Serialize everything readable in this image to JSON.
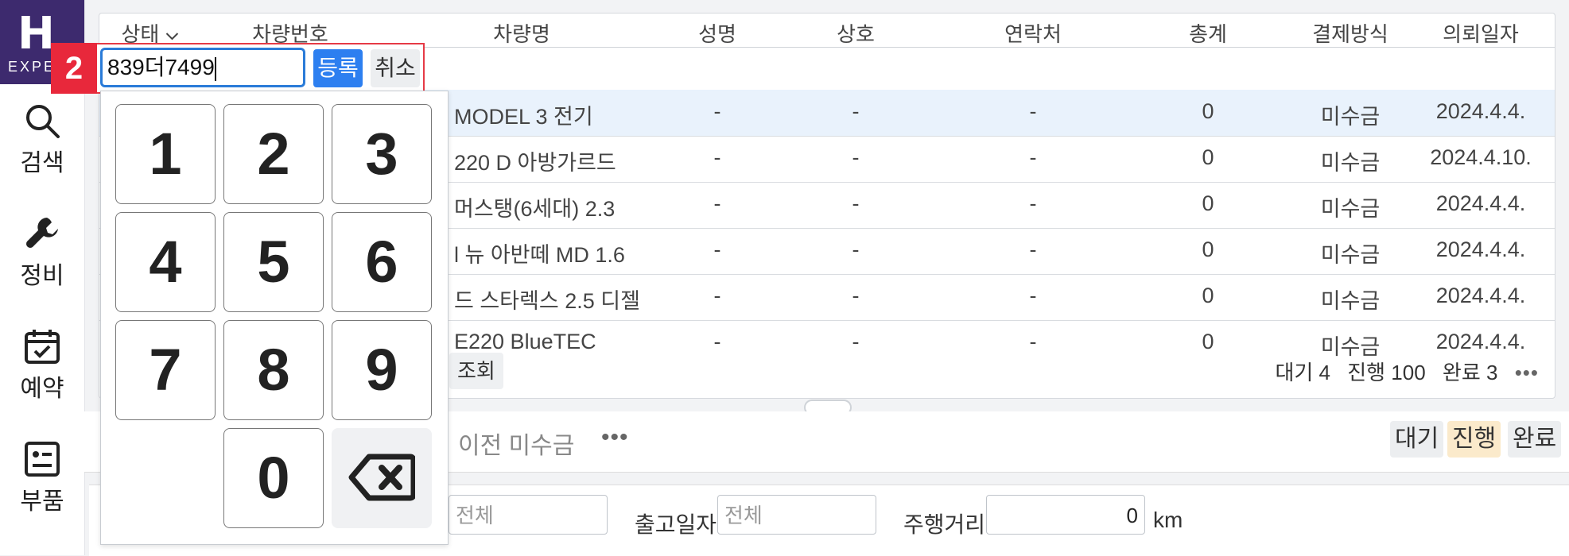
{
  "sidebar": {
    "logo_letter": "H",
    "logo_text": "EXPE",
    "items": [
      {
        "label": "검색",
        "icon": "search-icon"
      },
      {
        "label": "정비",
        "icon": "wrench-icon"
      },
      {
        "label": "예약",
        "icon": "calendar-check-icon"
      },
      {
        "label": "부품",
        "icon": "parts-icon"
      }
    ]
  },
  "table": {
    "headers": [
      "상태",
      "차량번호",
      "차량명",
      "성명",
      "상호",
      "연락처",
      "총계",
      "결제방식",
      "의뢰일자"
    ],
    "rows": [
      {
        "name": "MODEL 3 전기",
        "person": "-",
        "company": "-",
        "contact": "-",
        "total": "0",
        "payment": "미수금",
        "date": "2024.4.4.",
        "selected": true
      },
      {
        "name": "220 D 아방가르드",
        "person": "-",
        "company": "-",
        "contact": "-",
        "total": "0",
        "payment": "미수금",
        "date": "2024.4.10.",
        "selected": false
      },
      {
        "name": "머스탱(6세대) 2.3",
        "person": "-",
        "company": "-",
        "contact": "-",
        "total": "0",
        "payment": "미수금",
        "date": "2024.4.4.",
        "selected": false
      },
      {
        "name": "l 뉴 아반떼 MD 1.6",
        "person": "-",
        "company": "-",
        "contact": "-",
        "total": "0",
        "payment": "미수금",
        "date": "2024.4.4.",
        "selected": false
      },
      {
        "name": "드 스타렉스 2.5 디젤",
        "person": "-",
        "company": "-",
        "contact": "-",
        "total": "0",
        "payment": "미수금",
        "date": "2024.4.4.",
        "selected": false
      },
      {
        "name": "E220 BlueTEC",
        "person": "-",
        "company": "-",
        "contact": "-",
        "total": "0",
        "payment": "미수금",
        "date": "2024.4.4.",
        "selected": false
      }
    ],
    "query_button": "조회",
    "status": {
      "waiting": "대기 4",
      "progress": "진행 100",
      "done": "완료 3"
    }
  },
  "tabs": {
    "prev_unpaid": "이전 미수금",
    "chips": {
      "waiting": "대기",
      "progress": "진행",
      "done": "완료"
    }
  },
  "filters": {
    "all_placeholder": "전체",
    "release_date_label": "출고일자",
    "release_date_placeholder": "전체",
    "mileage_label": "주행거리",
    "mileage_value": "0",
    "mileage_unit": "km"
  },
  "plate_entry": {
    "step": "2",
    "value": "839더7499",
    "register": "등록",
    "cancel": "취소"
  },
  "keypad": {
    "keys": [
      "1",
      "2",
      "3",
      "4",
      "5",
      "6",
      "7",
      "8",
      "9",
      "0"
    ]
  },
  "colors": {
    "accent": "#2d7ff0",
    "step_badge": "#e8283b",
    "logo_bg": "#3d2a6e",
    "progress_chip": "#fbeacb"
  }
}
